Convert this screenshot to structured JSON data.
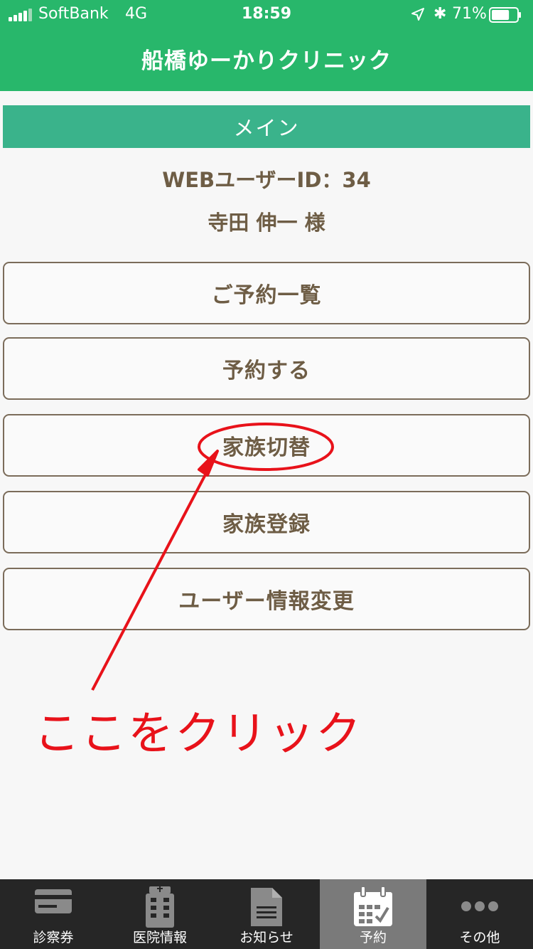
{
  "status_bar": {
    "carrier": "SoftBank",
    "network": "4G",
    "time": "18:59",
    "battery": "71%",
    "battery_level": 0.71
  },
  "header": {
    "title": "船橋ゆーかりクリニック"
  },
  "section": {
    "title": "メイン"
  },
  "user": {
    "id_line": "WEBユーザーID：34",
    "name_line": "寺田 伸一 様"
  },
  "menu": [
    {
      "label": "ご予約一覧"
    },
    {
      "label": "予約する"
    },
    {
      "label": "家族切替"
    },
    {
      "label": "家族登録"
    },
    {
      "label": "ユーザー情報変更"
    }
  ],
  "annotation": {
    "text": "ここをクリック",
    "color": "#e8121a"
  },
  "tabs": [
    {
      "label": "診察券",
      "icon": "card-icon"
    },
    {
      "label": "医院情報",
      "icon": "building-icon"
    },
    {
      "label": "お知らせ",
      "icon": "document-icon"
    },
    {
      "label": "予約",
      "icon": "calendar-icon",
      "active": true
    },
    {
      "label": "その他",
      "icon": "more-icon"
    }
  ],
  "colors": {
    "header_green": "#28b76b",
    "section_green": "#3ab38b",
    "text_brown": "#6e5d45",
    "tabbar_bg": "#262626",
    "tab_active_bg": "#7a7a7a"
  }
}
